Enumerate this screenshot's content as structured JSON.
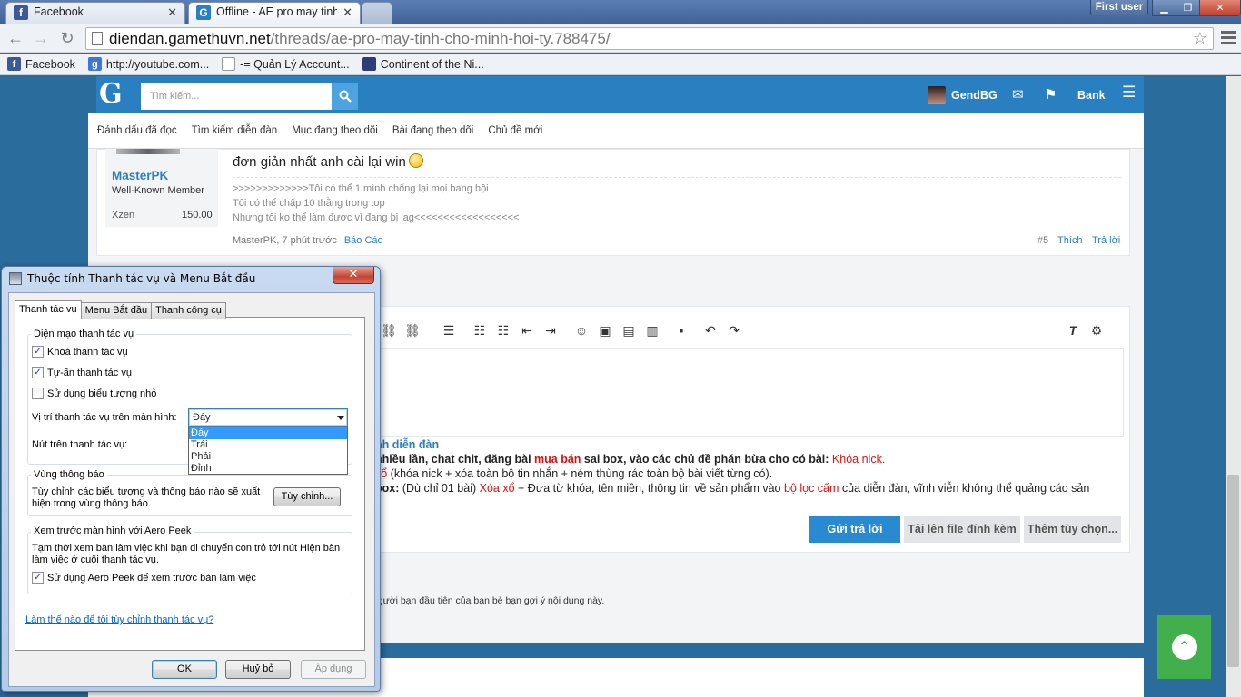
{
  "browser": {
    "tabs": [
      {
        "title": "Facebook",
        "favicon_letter": "f",
        "favicon_color": "#3b5998"
      },
      {
        "title": "Offline - AE pro may tinh c",
        "favicon_letter": "G",
        "favicon_color": "#2a7fc1"
      }
    ],
    "user_button": "First user",
    "url_domain": "diendan.gamethuvn.net",
    "url_path": "/threads/ae-pro-may-tinh-cho-minh-hoi-ty.788475/",
    "bookmarks": [
      {
        "label": "Facebook",
        "icon_letter": "f",
        "icon_color": "#3b5998"
      },
      {
        "label": "http://youtube.com...",
        "icon_letter": "g",
        "icon_color": "#3d78d8"
      },
      {
        "label": "-= Quản Lý Account...",
        "icon_letter": "",
        "icon_color": "#ffffff"
      },
      {
        "label": "Continent of the Ni...",
        "icon_letter": "",
        "icon_color": "#2b3d7a"
      }
    ]
  },
  "site": {
    "logo": "G",
    "search_placeholder": "Tìm kiếm...",
    "username": "GendBG",
    "bank_label": "Bank",
    "subnav": [
      "Đánh dấu đã đọc",
      "Tìm kiếm diễn đàn",
      "Mục đang theo dõi",
      "Bài đang theo dõi",
      "Chủ đề mới"
    ],
    "brand_color": "#2a7fc1"
  },
  "post": {
    "author": "MasterPK",
    "author_title": "Well-Known Member",
    "stat_label": "Xzen",
    "stat_value": "150.00",
    "message": "đơn giản nhất anh cài lại win",
    "signature": [
      ">>>>>>>>>>>>>Tôi có thể 1 mình chống lại mọi bang hội",
      "Tôi có thể chấp 10 thằng trong top",
      "Nhưng tôi ko thể làm được vì đang bị lag<<<<<<<<<<<<<<<<<<"
    ],
    "meta_time": "MasterPK, 7 phút trước",
    "report": "Báo Cáo",
    "post_number": "#5",
    "like": "Thích",
    "reply": "Trả lời"
  },
  "rules": {
    "title": "nh diễn đàn",
    "line1_a": "nhiều lần, chat chit, đăng bài ",
    "line1_b": "mua bán",
    "line1_c": " sai box, vào các chủ đề phán bừa cho có bài: ",
    "line1_d": "Khóa nick.",
    "line2_a": "xổ",
    "line2_b": " (khóa nick + xóa toàn bộ tin nhắn + ném thùng rác toàn bộ bài viết từng có).",
    "line3_a": "box:",
    "line3_b": " (Dù chỉ 01 bài) ",
    "line3_c": "Xóa xổ",
    "line3_d": " + Đưa từ khóa, tên miền, thông tin về sản phẩm vào ",
    "line3_e": "bộ lọc cấm",
    "line3_f": " của diễn đàn, vĩnh viễn không thể quảng cáo sản"
  },
  "editor": {
    "submit": "Gửi trả lời",
    "upload": "Tải lên file đính kèm",
    "more": "Thêm tùy chọn...",
    "suggest": "người bạn đầu tiên của bạn bè bạn gợi ý nội dung này."
  },
  "dialog": {
    "title": "Thuộc tính Thanh tác vụ và Menu Bắt đầu",
    "tabs": [
      "Thanh tác vụ",
      "Menu Bắt đầu",
      "Thanh công cụ"
    ],
    "group_appearance": "Diện mạo thanh tác vụ",
    "chk_lock": "Khoá thanh tác vụ",
    "chk_autohide": "Tự-ẩn thanh tác vụ",
    "chk_small": "Sử dụng biểu tượng nhỏ",
    "position_label": "Vị trí thanh tác vụ trên màn hình:",
    "position_value": "Đáy",
    "position_options": [
      "Đáy",
      "Trái",
      "Phải",
      "Đỉnh"
    ],
    "buttons_label": "Nút trên thanh tác vụ:",
    "group_notify": "Vùng thông báo",
    "notify_text_1": "Tùy chỉnh các biểu tượng và thông báo nào sẽ xuất",
    "notify_text_2": "hiện trong vùng thông báo.",
    "customize": "Tùy chỉnh...",
    "group_peek": "Xem trước màn hình với Aero Peek",
    "peek_text_1": "Tạm thời xem bàn làm việc khi bạn di chuyển con trỏ tới nút Hiện bàn",
    "peek_text_2": "làm việc ở cuối thanh tác vụ.",
    "chk_peek": "Sử dụng Aero Peek để xem trước bàn làm việc",
    "help_link": "Làm thế nào để tôi tùy chỉnh thanh tác vụ?",
    "ok": "OK",
    "cancel": "Huỷ bỏ",
    "apply": "Áp dụng"
  }
}
